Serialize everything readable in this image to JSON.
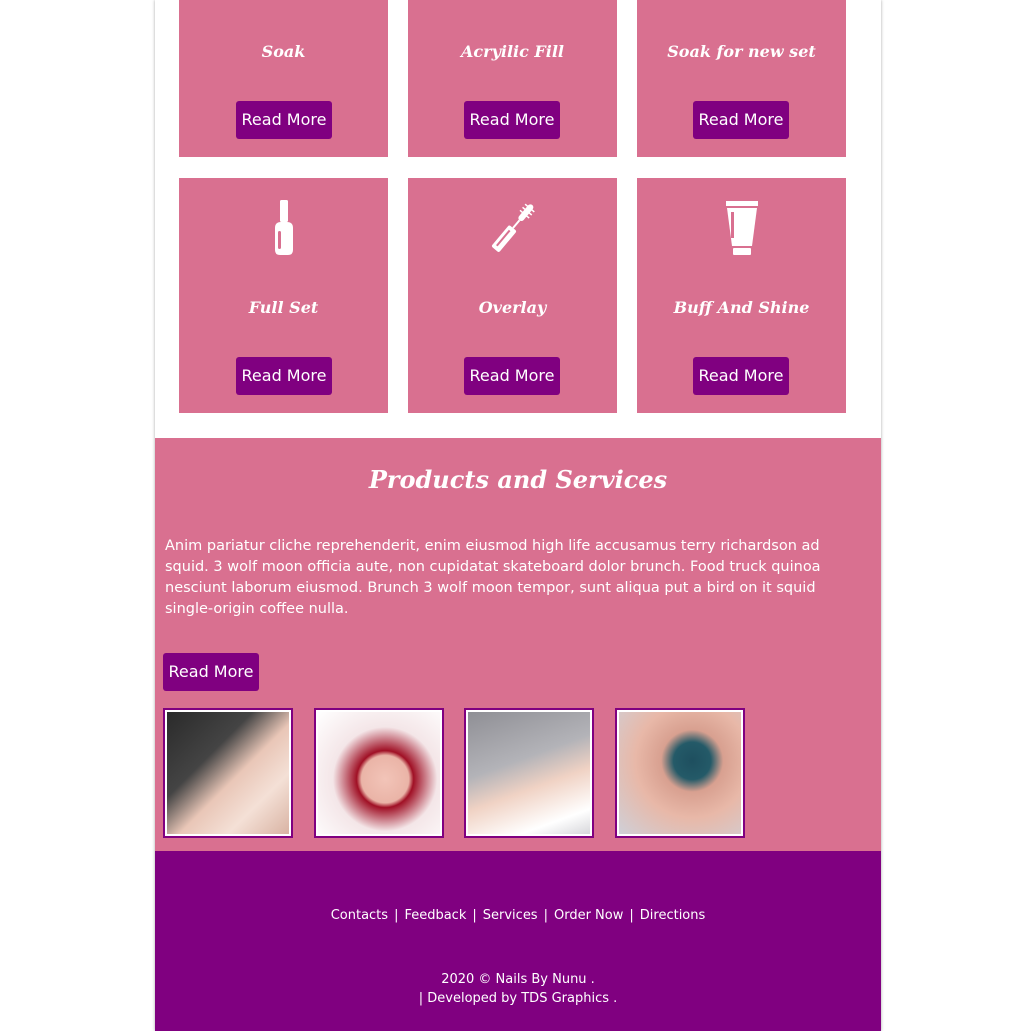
{
  "services": {
    "row1": [
      {
        "title": "Soak",
        "button": "Read More"
      },
      {
        "title": "Acryilic Fill",
        "button": "Read More"
      },
      {
        "title": "Soak for new set",
        "button": "Read More"
      }
    ],
    "row2": [
      {
        "title": "Full Set",
        "button": "Read More",
        "icon": "nail-polish-icon"
      },
      {
        "title": "Overlay",
        "button": "Read More",
        "icon": "mascara-brush-icon"
      },
      {
        "title": "Buff And Shine",
        "button": "Read More",
        "icon": "cream-tube-icon"
      }
    ]
  },
  "products": {
    "title": "Products and Services",
    "description": "Anim pariatur cliche reprehenderit, enim eiusmod high life accusamus terry richardson ad squid. 3 wolf moon officia aute, non cupidatat skateboard dolor brunch. Food truck quinoa nesciunt laborum eiusmod. Brunch 3 wolf moon tempor, sunt aliqua put a bird on it squid single-origin coffee nulla.",
    "button": "Read More"
  },
  "footer": {
    "links": [
      "Contacts",
      "Feedback",
      "Services",
      "Order Now",
      "Directions"
    ],
    "separator": "|",
    "copyright": "2020 ©  Nails By Nunu .",
    "developed": "| Developed by  TDS Graphics ."
  },
  "colors": {
    "card_pink": "#d97090",
    "button_purple": "#800080",
    "footer_purple": "#800080"
  }
}
